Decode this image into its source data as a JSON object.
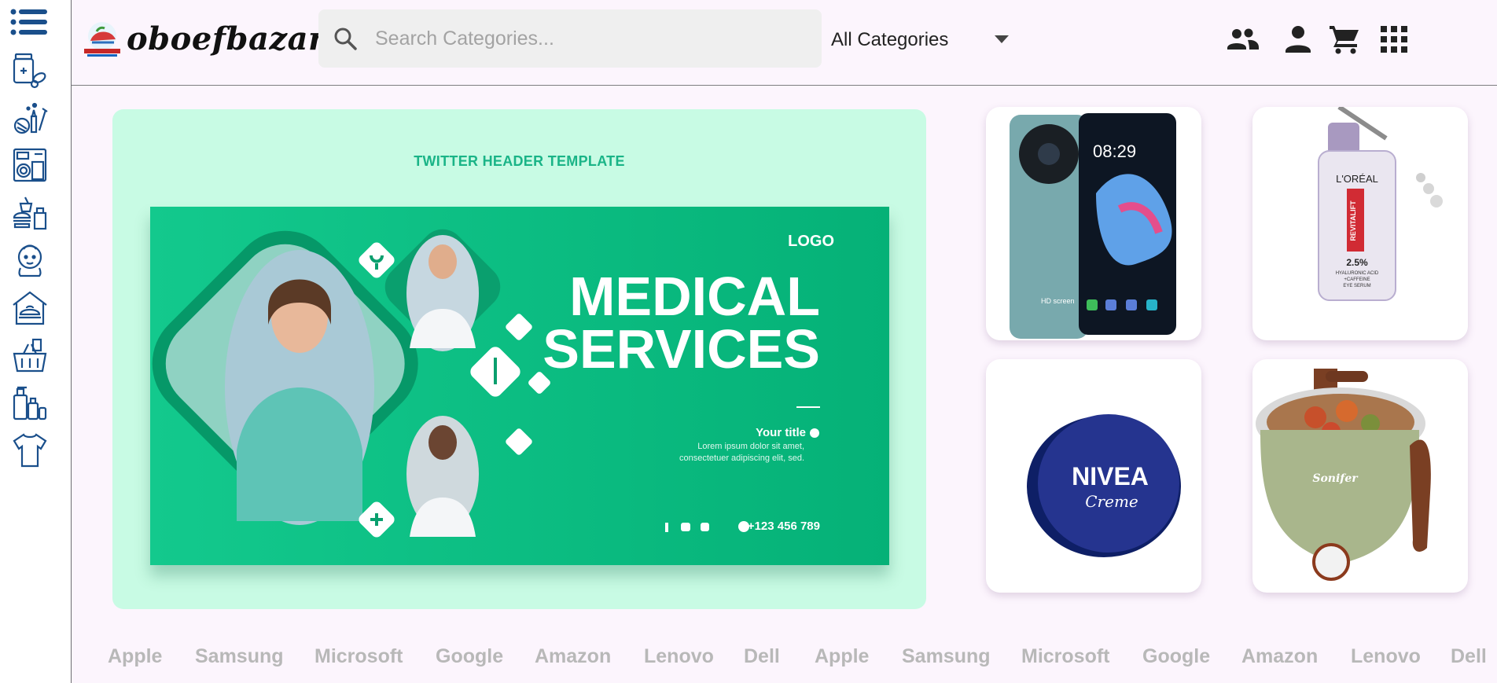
{
  "app": {
    "name": "oboefbazar",
    "logo_small_text": "OBOEFBAZAR"
  },
  "sidebar": {
    "categories": [
      {
        "name": "medicine-category",
        "icon": "pills-bottle-icon"
      },
      {
        "name": "beauty-category",
        "icon": "makeup-icon"
      },
      {
        "name": "appliances-category",
        "icon": "appliances-icon"
      },
      {
        "name": "food-category",
        "icon": "food-drink-icon"
      },
      {
        "name": "baby-category",
        "icon": "baby-icon"
      },
      {
        "name": "home-kitchen-category",
        "icon": "home-kitchen-icon"
      },
      {
        "name": "grocery-category",
        "icon": "grocery-basket-icon"
      },
      {
        "name": "personal-care-category",
        "icon": "bottles-icon"
      },
      {
        "name": "clothing-category",
        "icon": "tshirt-icon"
      }
    ]
  },
  "header": {
    "search_placeholder": "Search Categories...",
    "category_select": "All Categories",
    "icons": [
      "account-switch-icon",
      "user-icon",
      "cart-icon",
      "apps-grid-icon"
    ]
  },
  "banner": {
    "caption": "TWITTER HEADER TEMPLATE",
    "logo": "LOGO",
    "headline_1": "MEDICAL",
    "headline_2": "SERVICES",
    "your_title": "Your title",
    "body_1": "Lorem ipsum dolor sit amet,",
    "body_2": "consectetuer adipiscing elit, sed.",
    "phone": "+123 456 789",
    "colors": {
      "bg": "#c8fbe4",
      "green": "#08b97c",
      "caption": "#1ab487"
    }
  },
  "products": [
    {
      "name": "smartphone",
      "label": "HD screen",
      "time": "08:29"
    },
    {
      "name": "serum",
      "brand": "L'ORÉAL",
      "line": "REVITALIFT",
      "pct": "2.5%",
      "desc_1": "HYALURONIC ACID",
      "desc_2": "+CAFFEINE",
      "desc_3": "EYE SERUM"
    },
    {
      "name": "nivea-creme",
      "brand": "NIVEA",
      "sub": "Creme"
    },
    {
      "name": "electric-pot",
      "brand": "Sonifer"
    }
  ],
  "brands": [
    "Apple",
    "Samsung",
    "Microsoft",
    "Google",
    "Amazon",
    "Lenovo",
    "Dell",
    "Apple",
    "Samsung",
    "Microsoft",
    "Google",
    "Amazon",
    "Lenovo",
    "Dell"
  ]
}
